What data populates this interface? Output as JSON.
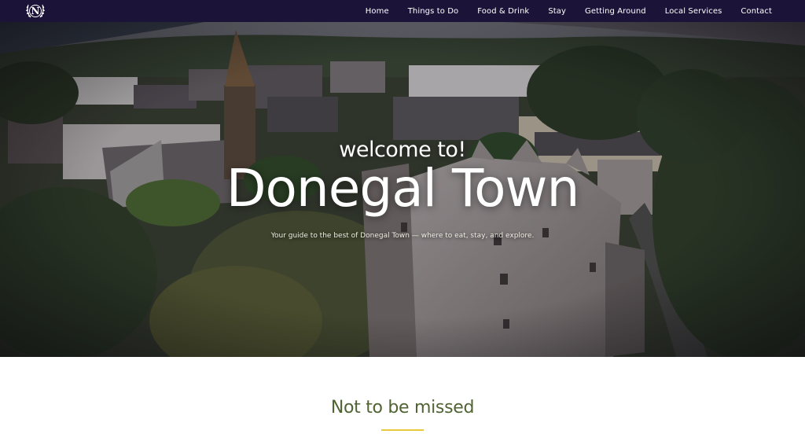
{
  "nav": {
    "logo_letter": "N",
    "links": [
      "Home",
      "Things to Do",
      "Food & Drink",
      "Stay",
      "Getting Around",
      "Local Services",
      "Contact"
    ]
  },
  "hero": {
    "kicker": "welcome to!",
    "title": "Donegal Town",
    "subtitle": "Your guide to the best of Donegal Town — where to eat, stay, and explore."
  },
  "section": {
    "title": "Not to be missed"
  },
  "colors": {
    "nav_bg": "#1b1438",
    "section_title": "#4f6333",
    "accent_rule": "#e7c93b"
  },
  "icons": {
    "logo": "laurel-wreath-icon"
  }
}
